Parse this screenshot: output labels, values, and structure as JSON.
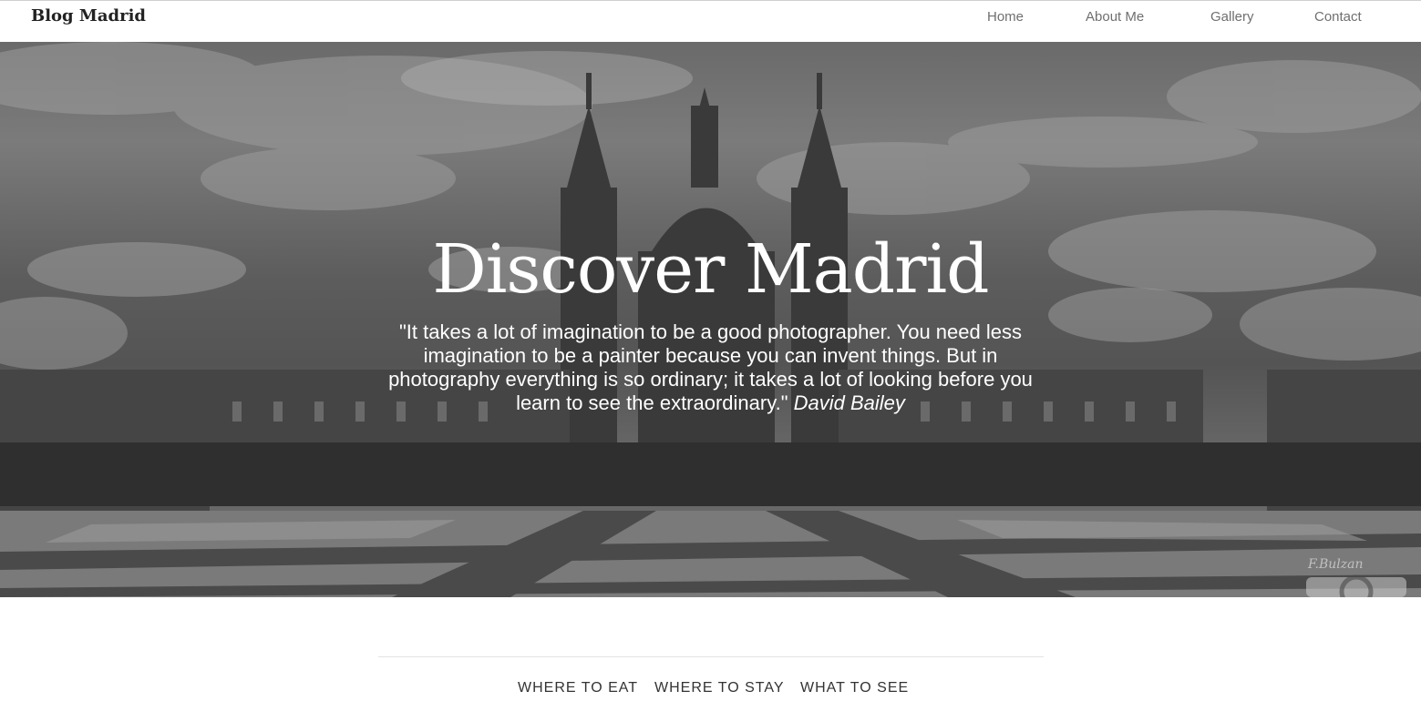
{
  "header": {
    "brand": "Blog Madrid",
    "nav": [
      {
        "label": "Home"
      },
      {
        "label": "About Me"
      },
      {
        "label": "Gallery"
      },
      {
        "label": "Contact"
      }
    ]
  },
  "hero": {
    "title": "Discover Madrid",
    "quote": "\"It takes a lot of imagination to be a good photographer. You need less imagination to be a painter because you can invent things. But in photography everything is so ordinary; it takes a lot of looking before you learn to see the extraordinary.\"",
    "author": "David Bailey",
    "watermark": "F.Bulzan"
  },
  "categories": [
    {
      "label": "WHERE TO EAT"
    },
    {
      "label": "WHERE TO STAY"
    },
    {
      "label": "WHAT TO SEE"
    }
  ],
  "colors": {
    "header_bg": "#ffffff",
    "hero_overlay": "#5e5e5e",
    "hero_text": "#ffffff",
    "nav_text": "#6f6f6f"
  }
}
